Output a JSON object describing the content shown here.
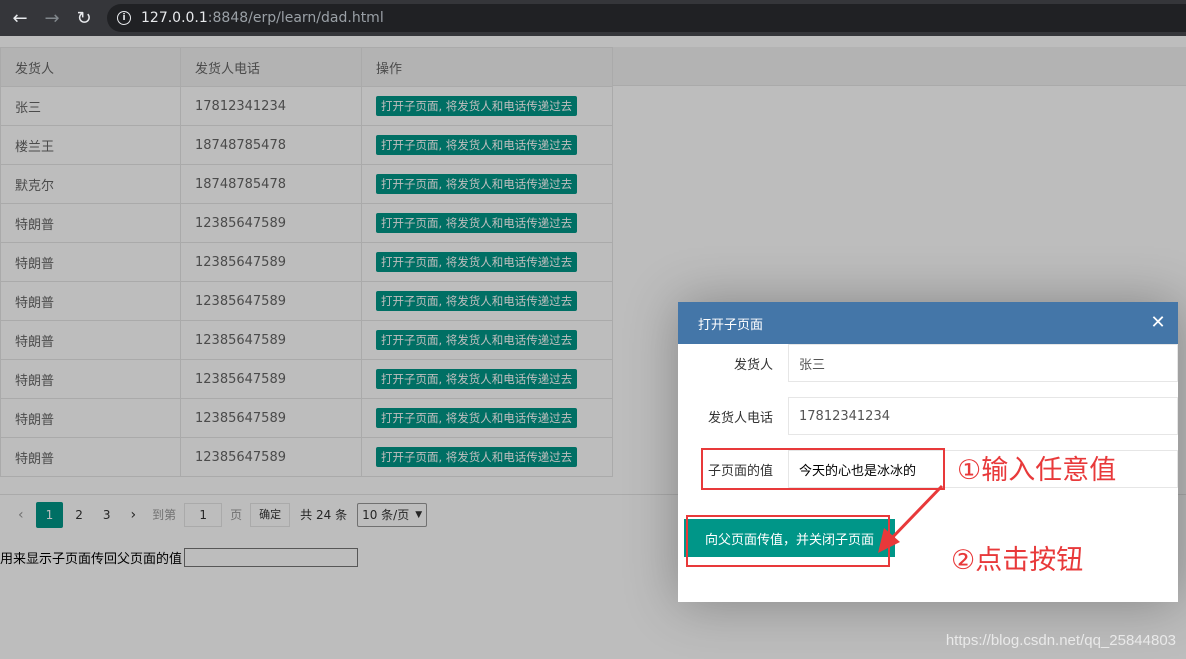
{
  "browser": {
    "url_host": "127.0.0.1",
    "url_rest": ":8848/erp/learn/dad.html"
  },
  "table": {
    "headers": [
      "发货人",
      "发货人电话",
      "操作"
    ],
    "rows": [
      {
        "name": "张三",
        "phone": "17812341234",
        "action": "打开子页面, 将发货人和电话传递过去"
      },
      {
        "name": "楼兰王",
        "phone": "18748785478",
        "action": "打开子页面, 将发货人和电话传递过去"
      },
      {
        "name": "默克尔",
        "phone": "18748785478",
        "action": "打开子页面, 将发货人和电话传递过去"
      },
      {
        "name": "特朗普",
        "phone": "12385647589",
        "action": "打开子页面, 将发货人和电话传递过去"
      },
      {
        "name": "特朗普",
        "phone": "12385647589",
        "action": "打开子页面, 将发货人和电话传递过去"
      },
      {
        "name": "特朗普",
        "phone": "12385647589",
        "action": "打开子页面, 将发货人和电话传递过去"
      },
      {
        "name": "特朗普",
        "phone": "12385647589",
        "action": "打开子页面, 将发货人和电话传递过去"
      },
      {
        "name": "特朗普",
        "phone": "12385647589",
        "action": "打开子页面, 将发货人和电话传递过去"
      },
      {
        "name": "特朗普",
        "phone": "12385647589",
        "action": "打开子页面, 将发货人和电话传递过去"
      },
      {
        "name": "特朗普",
        "phone": "12385647589",
        "action": "打开子页面, 将发货人和电话传递过去"
      }
    ]
  },
  "pager": {
    "pages": [
      "1",
      "2",
      "3"
    ],
    "current": "1",
    "goto_label": "到第",
    "goto_value": "1",
    "page_unit": "页",
    "confirm": "确定",
    "total": "共 24 条",
    "per_page": "10 条/页"
  },
  "return_label": "用来显示子页面传回父页面的值",
  "modal": {
    "title": "打开子页面",
    "fields": [
      {
        "label": "发货人",
        "value": "张三"
      },
      {
        "label": "发货人电话",
        "value": "17812341234"
      },
      {
        "label": "子页面的值",
        "value": "今天的心也是冰冰的"
      }
    ],
    "submit": "向父页面传值，并关闭子页面"
  },
  "annotations": {
    "step1": "①输入任意值",
    "step2": "②点击按钮"
  },
  "watermark": "https://blog.csdn.net/qq_25844803",
  "colors": {
    "accent": "#009688",
    "modal_header": "#4476a8",
    "annotation": "#e8393a"
  }
}
